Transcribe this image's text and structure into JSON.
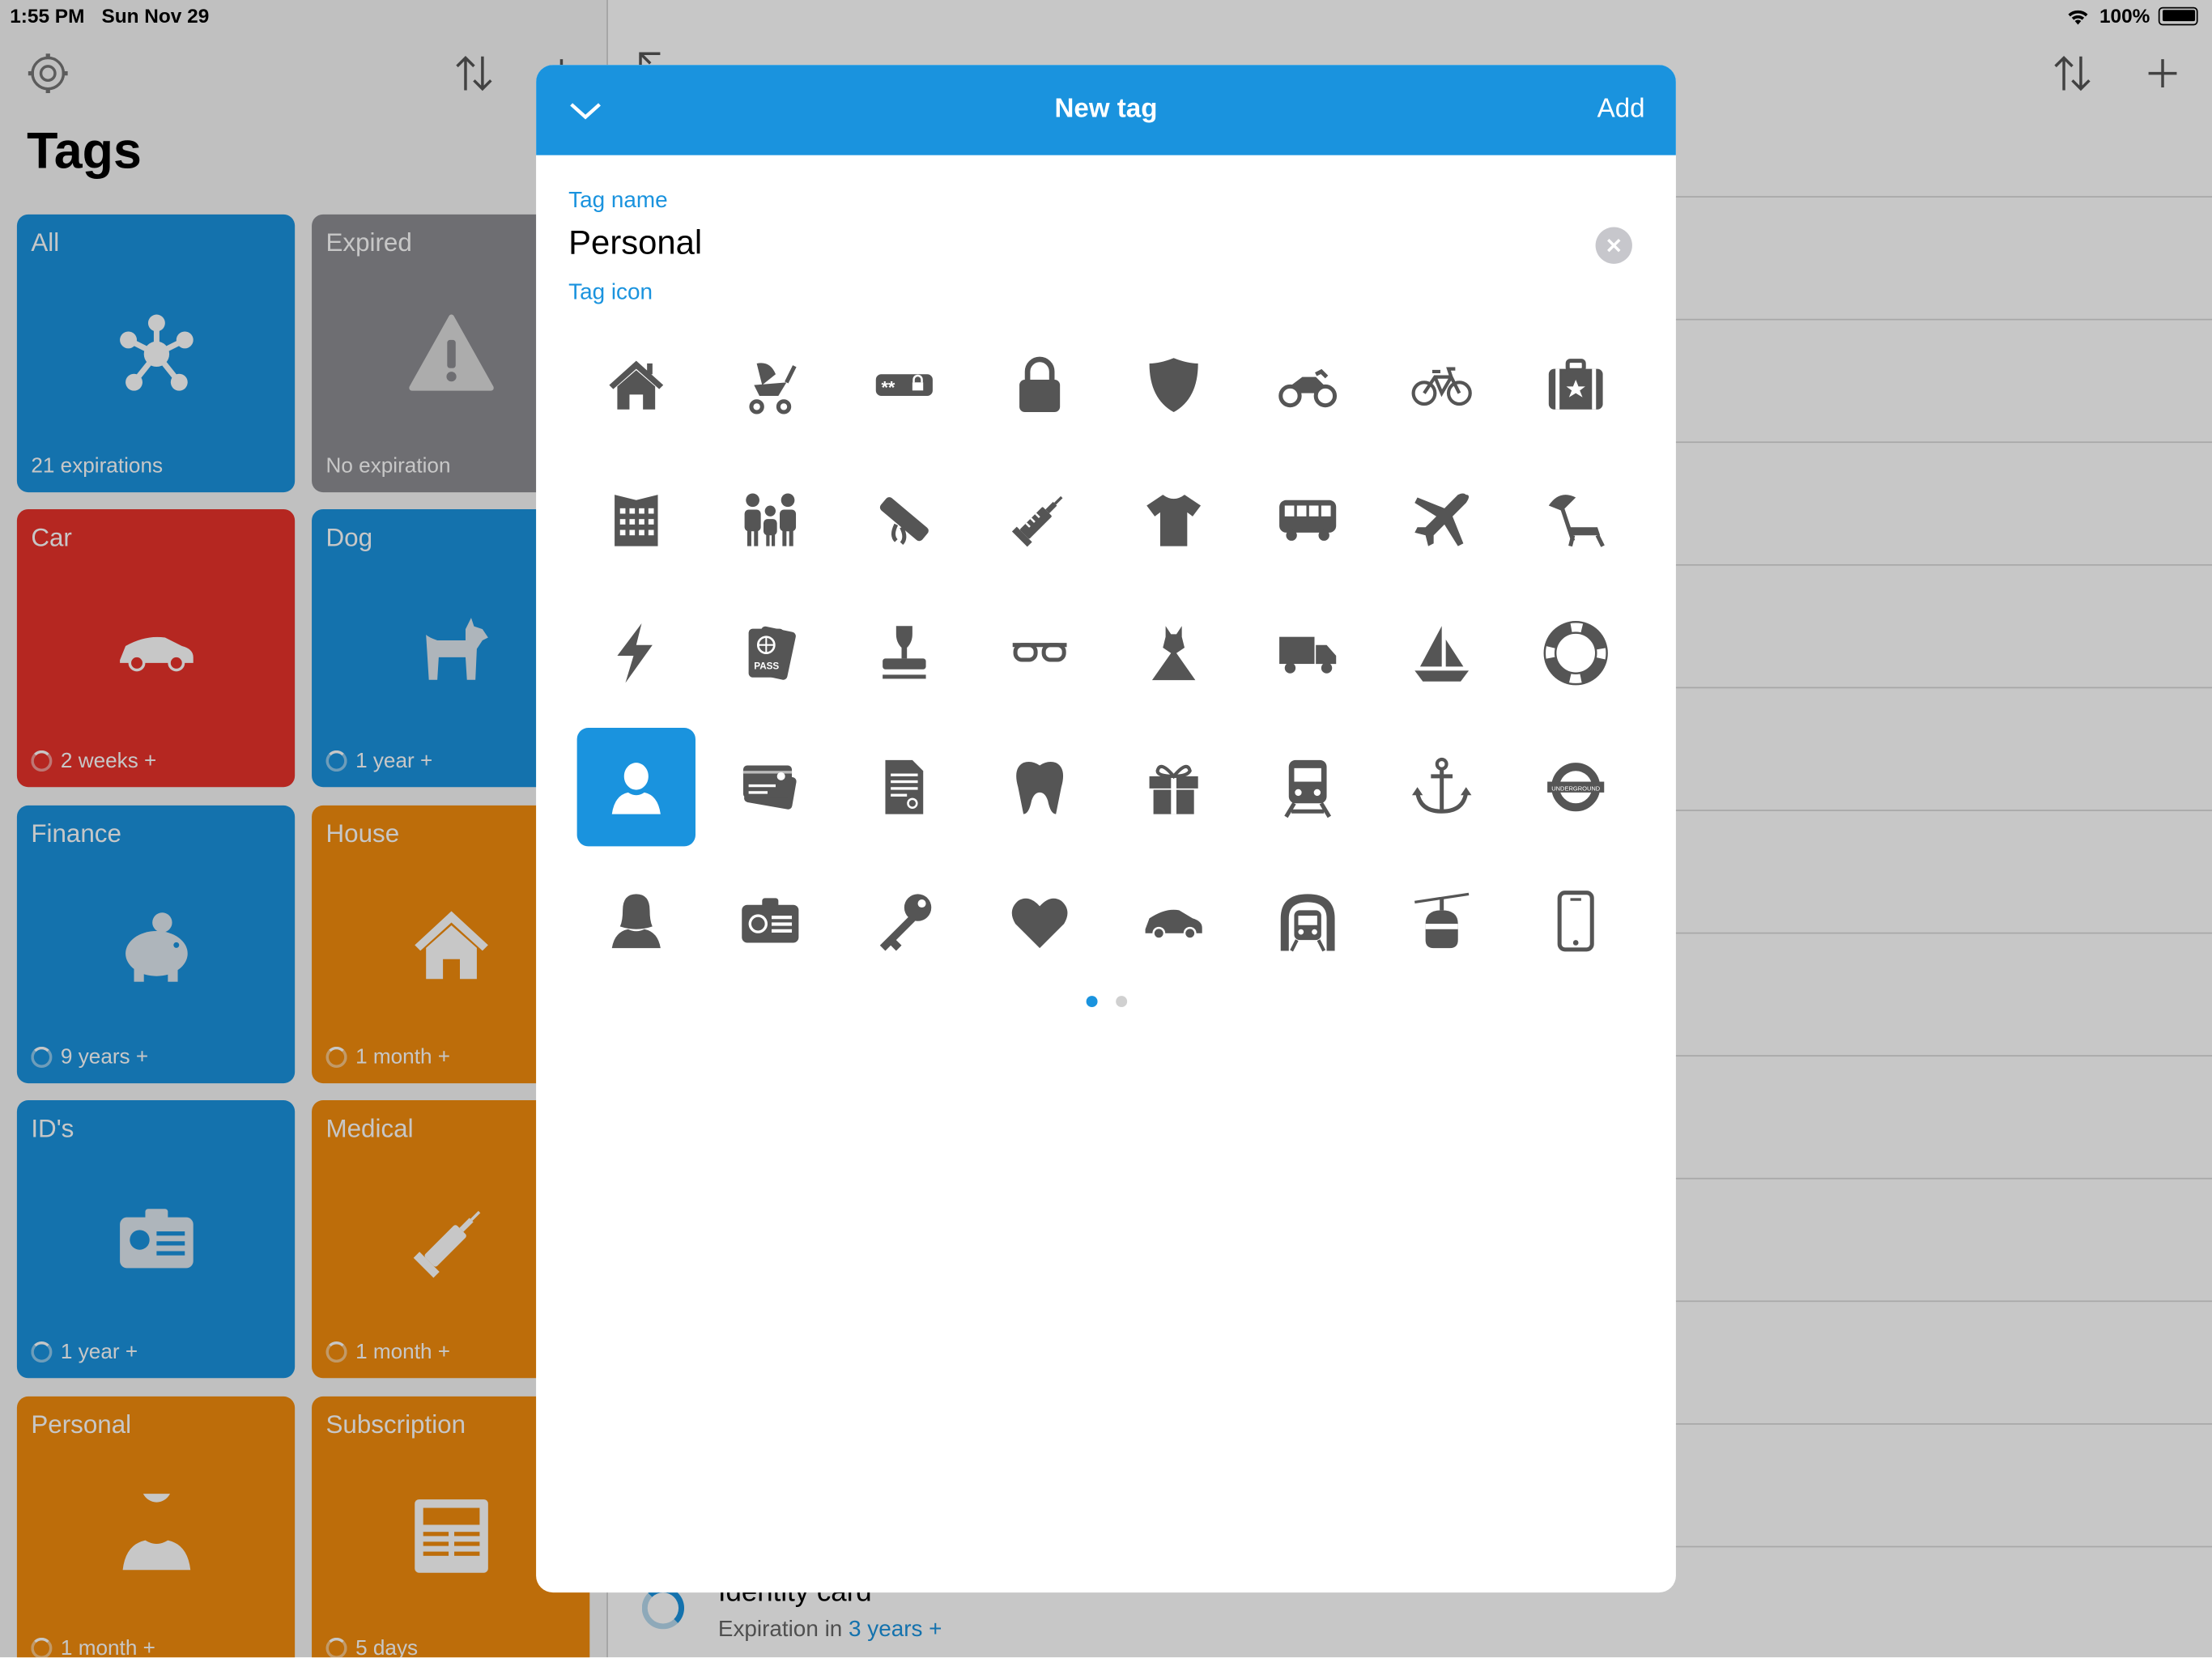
{
  "status_bar": {
    "time": "1:55 PM",
    "date": "Sun Nov 29",
    "battery": "100%"
  },
  "sidebar": {
    "title": "Tags",
    "tiles": [
      {
        "name": "All",
        "subtitle": "21 expirations",
        "color": "#1a93de",
        "icon": "network-icon"
      },
      {
        "name": "Expired",
        "subtitle": "No expiration",
        "color": "#8e8e93",
        "icon": "warning-icon"
      },
      {
        "name": "Car",
        "subtitle": "2 weeks +",
        "color": "#e8322b",
        "icon": "car-icon"
      },
      {
        "name": "Dog",
        "subtitle": "1 year +",
        "color": "#1a93de",
        "icon": "dog-icon"
      },
      {
        "name": "Finance",
        "subtitle": "9 years +",
        "color": "#1a93de",
        "icon": "piggy-bank-icon"
      },
      {
        "name": "House",
        "subtitle": "1 month +",
        "color": "#f38c0d",
        "icon": "house-icon"
      },
      {
        "name": "ID's",
        "subtitle": "1 year +",
        "color": "#1a93de",
        "icon": "id-card-icon"
      },
      {
        "name": "Medical",
        "subtitle": "1 month +",
        "color": "#f38c0d",
        "icon": "syringe-icon"
      },
      {
        "name": "Personal",
        "subtitle": "1 month +",
        "color": "#f38c0d",
        "icon": "person-icon"
      },
      {
        "name": "Subscription",
        "subtitle": "5 days",
        "color": "#f38c0d",
        "icon": "newspaper-icon"
      }
    ]
  },
  "detail": {
    "visible_item": {
      "title": "Identity card",
      "subtitle_prefix": "Expiration in",
      "subtitle_value": "3 years +"
    }
  },
  "modal": {
    "title": "New tag",
    "add_label": "Add",
    "tag_name_label": "Tag name",
    "tag_name_value": "Personal",
    "tag_icon_label": "Tag icon",
    "selected_icon": "person-icon",
    "current_page": 1,
    "page_count": 2,
    "icons": [
      "house-icon",
      "stroller-icon",
      "password-icon",
      "lock-icon",
      "shield-icon",
      "motorcycle-icon",
      "bicycle-icon",
      "suitcase-icon",
      "building-icon",
      "family-icon",
      "diploma-icon",
      "syringe-icon",
      "tshirt-icon",
      "bus-icon",
      "airplane-icon",
      "beach-chair-icon",
      "lightning-icon",
      "passport-icon",
      "stamp-icon",
      "glasses-icon",
      "dress-icon",
      "truck-icon",
      "sailboat-icon",
      "lifebuoy-icon",
      "person-icon",
      "credit-card-icon",
      "document-icon",
      "tooth-icon",
      "gift-icon",
      "train-icon",
      "anchor-icon",
      "underground-icon",
      "woman-icon",
      "id-card-icon",
      "key-icon",
      "heart-icon",
      "car-icon",
      "metro-icon",
      "cable-car-icon",
      "smartphone-icon"
    ],
    "colors": {
      "accent": "#1a93de",
      "icon": "#555555"
    }
  }
}
